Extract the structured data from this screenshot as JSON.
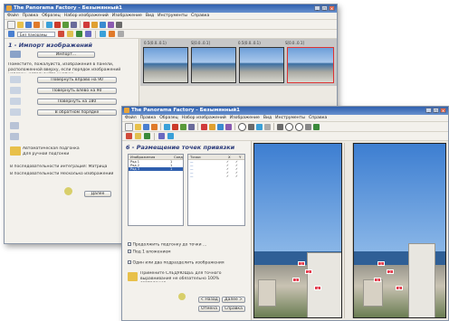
{
  "back_window": {
    "title": "The Panorama Factory - Безымянный1",
    "menu": [
      "Файл",
      "Правка",
      "Образец",
      "Набор изображений",
      "Изображение",
      "Вид",
      "Инструменты",
      "Справка"
    ],
    "toolbar2_combo": "Без панорамы",
    "panel_title": "1 - Импорт изображений",
    "import_button": "Импорт...",
    "description": "Поместите, пожалуйста, изображения в панели, расположенной вверху, если порядок изображений неверен, используйте кнопки:",
    "step_buttons": [
      "Повернуть вправо на 90",
      "Повернуть влево на 90",
      "Повернуть на 180",
      "В обратном порядке"
    ],
    "auto_label": "Автоматическая подгонка",
    "manual_label": "Для ручной подгонки",
    "radio1": "В последовательности",
    "radio2": "В последовательности",
    "radio1_b": "интеграция: Матрица",
    "radio2_b": "Несколько изображений",
    "next_button": "Далее",
    "thumb_captions": [
      "0.5(0.0..0.1)",
      "S[0.0..0.1]",
      "0.5(0.0..0.1)",
      "S[0.0..0.1]"
    ],
    "brand_color": "#2e5fae"
  },
  "front_window": {
    "title": "The Panorama Factory - Безымянный1",
    "menu": [
      "Файл",
      "Правка",
      "Образец",
      "Набор изображений",
      "Изображение",
      "Вид",
      "Инструменты",
      "Справка"
    ],
    "panel_title": "6 - Размещение точек привязки",
    "list_left_headers": [
      "Изображения",
      "Соед"
    ],
    "list_left_rows": [
      {
        "name": "Ряд 1",
        "val": "1"
      },
      {
        "name": "Ряд 2",
        "val": "1"
      },
      {
        "name": "Ряд 3",
        "val": "1"
      }
    ],
    "list_right_headers": [
      "Точки",
      "X",
      "Y"
    ],
    "check_options": [
      "Продолжить подгонку до точки ...",
      "Под 1 вложением",
      "Один или два подразделить изображения"
    ],
    "info_text": "Примените СЛЕДУЮЩЕЕ для точного выравнивания не обязательно 100% совпадения",
    "back_button": "< Назад",
    "next_button": "Далее >",
    "extra_button1": "Отмена",
    "extra_button2": "Справка",
    "control_points": [
      "1",
      "2",
      "3",
      "4",
      "5",
      "6"
    ]
  }
}
